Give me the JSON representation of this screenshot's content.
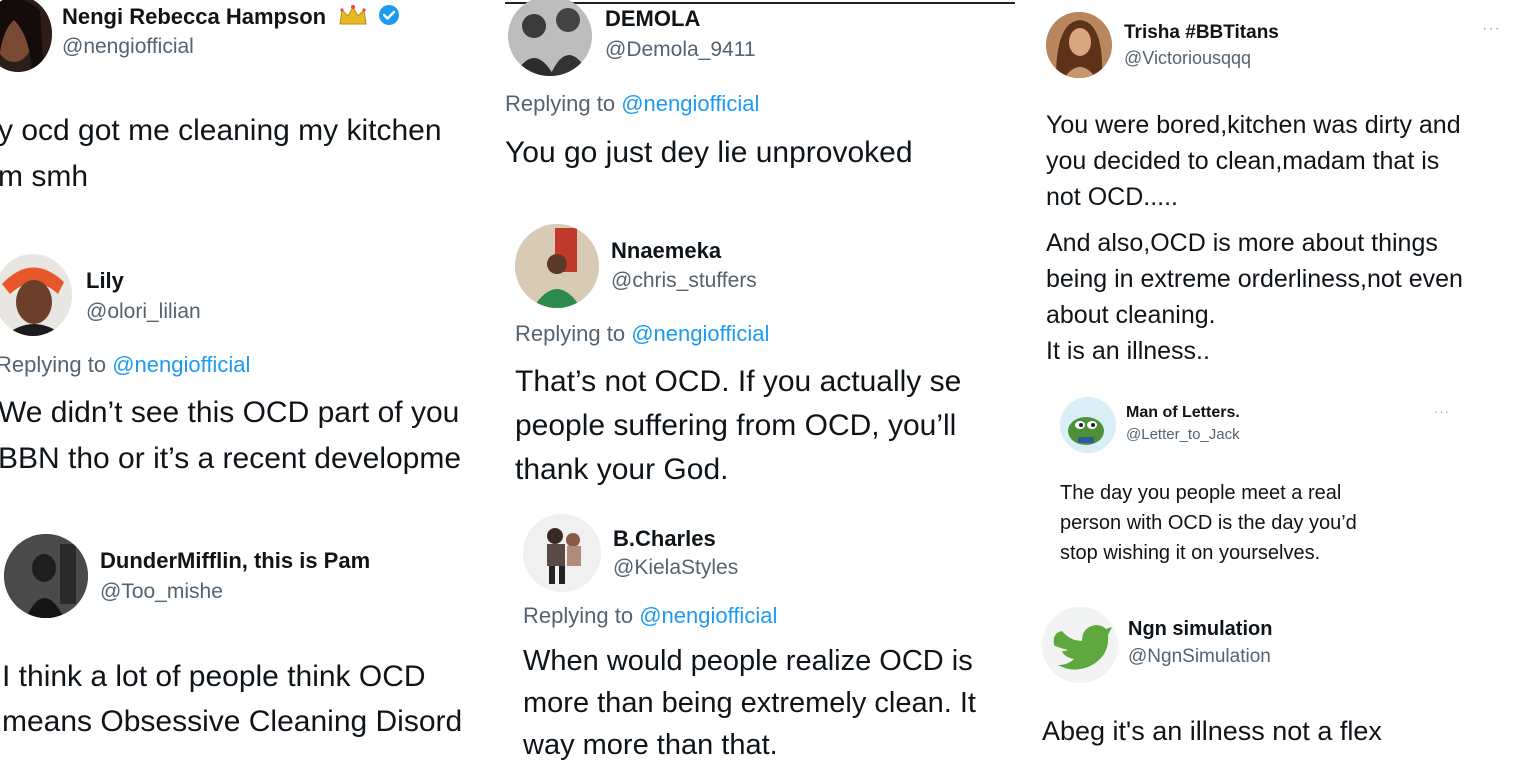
{
  "col1": {
    "t1": {
      "name": "Nengi Rebecca Hampson",
      "handle": "@nengiofficial",
      "line1": "y ocd got me cleaning my kitchen",
      "line2": "m smh"
    },
    "t2": {
      "name": "Lily",
      "handle": "@olori_lilian",
      "replying": "Replying to",
      "mention": "@nengiofficial",
      "line1": "We didn’t see this OCD part of you",
      "line2": "BBN tho or it’s a recent developme"
    },
    "t3": {
      "name": "DunderMifflin, this is Pam",
      "handle": "@Too_mishe",
      "line1": "I think a lot of people think OCD",
      "line2": "means Obsessive Cleaning Disord"
    }
  },
  "col2": {
    "t1": {
      "name": "DEMOLA",
      "handle": "@Demola_9411",
      "replying": "Replying to",
      "mention": "@nengiofficial",
      "line1": "You go just dey lie unprovoked"
    },
    "t2": {
      "name": "Nnaemeka",
      "handle": "@chris_stuffers",
      "replying": "Replying to",
      "mention": "@nengiofficial",
      "line1": "That’s not OCD. If you actually se",
      "line2": "people suffering from OCD, you’ll",
      "line3": "thank your God."
    },
    "t3": {
      "name": "B.Charles",
      "handle": "@KielaStyles",
      "replying": "Replying to",
      "mention": "@nengiofficial",
      "line1": "When would people realize OCD is",
      "line2": "more than being extremely clean. It",
      "line3": "way more than that."
    }
  },
  "col3": {
    "t1": {
      "name": "Trisha #BBTitans",
      "handle": "@Victoriousqqq",
      "more": "···",
      "line1": "You were bored,kitchen was dirty and",
      "line2": "you decided to clean,madam that is",
      "line3": "not OCD.....",
      "line4": "And also,OCD is more about things",
      "line5": "being in extreme orderliness,not even",
      "line6": "about cleaning.",
      "line7": "It is an illness.."
    },
    "t2": {
      "name": "Man of Letters.",
      "handle": "@Letter_to_Jack",
      "more": "···",
      "line1": "The day you people meet a real",
      "line2": "person with OCD is the day you’d",
      "line3": "stop wishing it on yourselves."
    },
    "t3": {
      "name": "Ngn simulation",
      "handle": "@NgnSimulation",
      "line1": "Abeg it's an illness not a flex"
    }
  },
  "colors": {
    "text": "#0f1419",
    "muted": "#536471",
    "link": "#1d9bf0",
    "verified": "#1d9bf0",
    "bird": "#5fa83f"
  },
  "icons": [
    "verified-badge-icon",
    "crown-emoji-icon",
    "more-options-icon",
    "twitter-bird-icon"
  ]
}
